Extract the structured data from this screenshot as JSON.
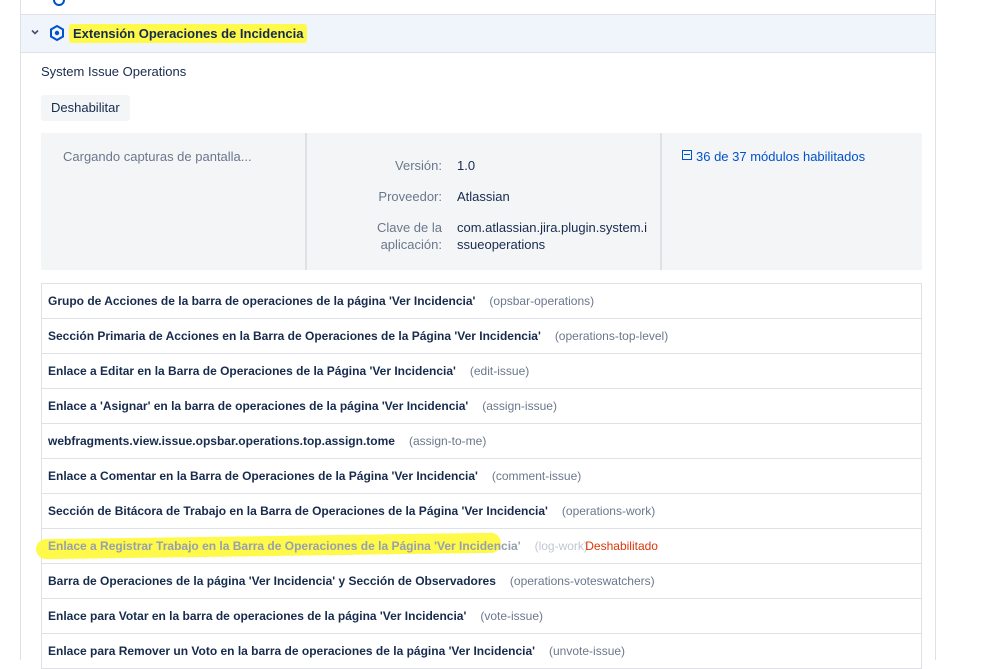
{
  "plugin": {
    "title": "Extensión Operaciones de Incidencia",
    "subtitle": "System Issue Operations",
    "disable_button": "Deshabilitar",
    "loading_screens": "Cargando capturas de pantalla...",
    "version_label": "Versión:",
    "version_value": "1.0",
    "vendor_label": "Proveedor:",
    "vendor_value": "Atlassian",
    "key_label_line1": "Clave de la",
    "key_label_line2": "aplicación:",
    "key_value_line1": "com.atlassian.jira.plugin.system.i",
    "key_value_line2": "ssueoperations",
    "modules_link": "36 de 37 módulos habilitados"
  },
  "modules": [
    {
      "name": "Grupo de Acciones de la barra de operaciones de la página 'Ver Incidencia'",
      "key": "(opsbar-operations)"
    },
    {
      "name": "Sección Primaria de Acciones en la Barra de Operaciones de la Página 'Ver Incidencia'",
      "key": "(operations-top-level)"
    },
    {
      "name": "Enlace a Editar en la Barra de Operaciones de la Página 'Ver Incidencia'",
      "key": "(edit-issue)"
    },
    {
      "name": "Enlace a 'Asignar' en la barra de operaciones de la página 'Ver Incidencia'",
      "key": "(assign-issue)"
    },
    {
      "name": "webfragments.view.issue.opsbar.operations.top.assign.tome",
      "key": "(assign-to-me)"
    },
    {
      "name": "Enlace a Comentar en la Barra de Operaciones de la Página 'Ver Incidencia'",
      "key": "(comment-issue)"
    },
    {
      "name": "Sección de Bitácora de Trabajo en la Barra de Operaciones de la Página 'Ver Incidencia'",
      "key": "(operations-work)"
    },
    {
      "name": "Enlace a Registrar Trabajo en la Barra de Operaciones de la Página 'Ver Incidencia'",
      "key": "(log-work)",
      "status": "Deshabilitado"
    },
    {
      "name": "Barra de Operaciones de la página 'Ver Incidencia' y Sección de Observadores",
      "key": "(operations-voteswatchers)"
    },
    {
      "name": "Enlace para Votar en la barra de operaciones de la página 'Ver Incidencia'",
      "key": "(vote-issue)"
    },
    {
      "name": "Enlace para Remover un Voto en la barra de operaciones de la página 'Ver Incidencia'",
      "key": "(unvote-issue)"
    }
  ],
  "colors": {
    "highlight": "#fff94a",
    "link": "#0052cc",
    "disabled_status": "#de350b",
    "header_bg": "#f0f4fb"
  }
}
